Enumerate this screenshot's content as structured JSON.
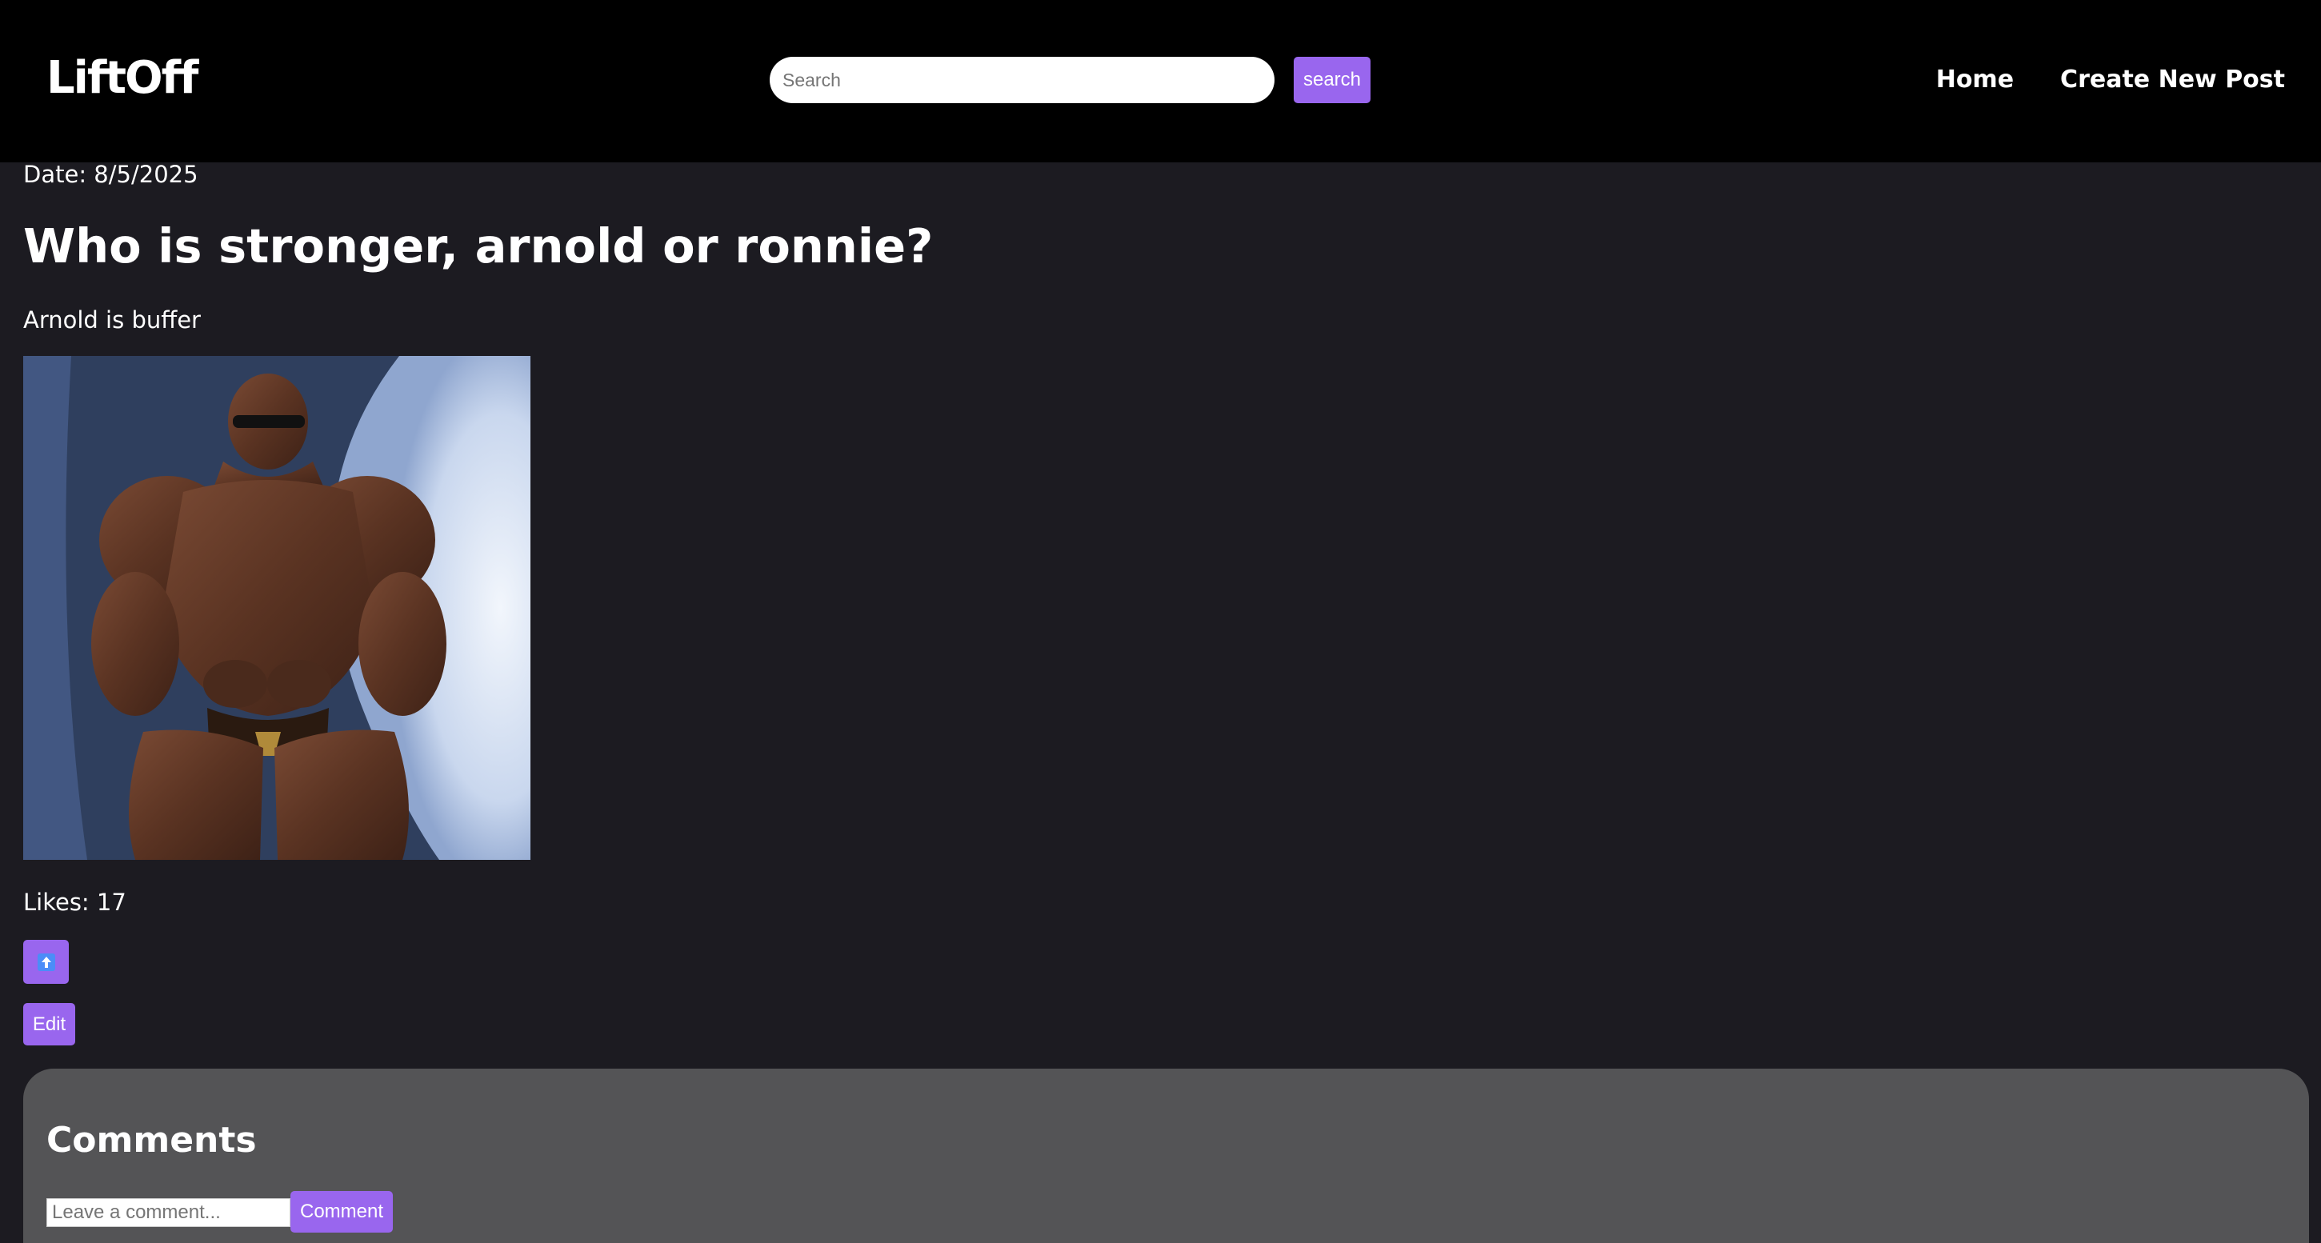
{
  "header": {
    "logo": "LiftOff",
    "search": {
      "placeholder": "Search",
      "value": "",
      "button_label": "search"
    },
    "nav": [
      {
        "label": "Home"
      },
      {
        "label": "Create New Post"
      }
    ]
  },
  "post": {
    "date_label": "Date: 8/5/2025",
    "title": "Who is stronger, arnold or ronnie?",
    "body": "Arnold is buffer",
    "image": {
      "description_icon": "bodybuilder-photo"
    },
    "likes_label": "Likes: 17",
    "like_icon": "up-arrow-icon",
    "edit_label": "Edit"
  },
  "comments": {
    "title": "Comments",
    "input_placeholder": "Leave a comment...",
    "input_value": "",
    "submit_label": "Comment"
  },
  "colors": {
    "header_bg": "#000000",
    "page_bg": "#1c1b21",
    "accent": "#9966ee",
    "comments_bg": "#545456"
  }
}
